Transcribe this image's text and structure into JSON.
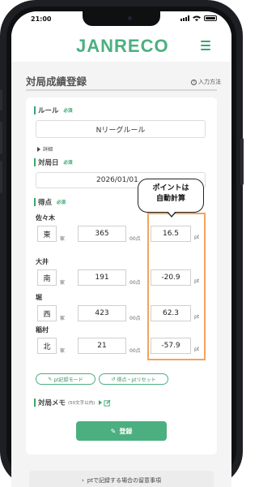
{
  "status_bar": {
    "time": "21:00"
  },
  "header": {
    "logo": "JANRECO"
  },
  "page": {
    "title": "対局成績登録",
    "howto_label": "入力方法"
  },
  "rule": {
    "label": "ルール",
    "required": "必須",
    "value": "Nリーグルール",
    "details_label": "詳細"
  },
  "date": {
    "label": "対局日",
    "required": "必須",
    "value": "2026/01/01"
  },
  "score": {
    "label": "得点",
    "required": "必須"
  },
  "players": [
    {
      "name": "佐々木",
      "seat": "東",
      "house": "家",
      "score": "365",
      "unit": "00点",
      "pt": "16.5",
      "pt_unit": "pt"
    },
    {
      "name": "大井",
      "seat": "南",
      "house": "家",
      "score": "191",
      "unit": "00点",
      "pt": "-20.9",
      "pt_unit": "pt"
    },
    {
      "name": "堀",
      "seat": "西",
      "house": "家",
      "score": "423",
      "unit": "00点",
      "pt": "62.3",
      "pt_unit": "pt"
    },
    {
      "name": "稲村",
      "seat": "北",
      "house": "家",
      "score": "21",
      "unit": "00点",
      "pt": "-57.9",
      "pt_unit": "pt"
    }
  ],
  "buttons": {
    "pt_mode": "pt記録モード",
    "reset": "得点・ptリセット",
    "submit": "登録"
  },
  "memo": {
    "label": "対局メモ",
    "hint": "(50文字以内)"
  },
  "callout": {
    "line1": "ポイントは",
    "line2": "自動計算"
  },
  "footer": {
    "note": "ptで記録する場合の留意事項"
  },
  "colors": {
    "accent": "#4caf80",
    "highlight": "#f0a460"
  }
}
